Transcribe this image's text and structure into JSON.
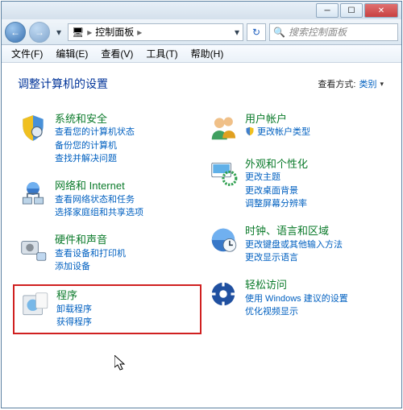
{
  "window": {
    "min_icon": "─",
    "max_icon": "☐",
    "close_icon": "✕"
  },
  "nav": {
    "back_glyph": "←",
    "fwd_glyph": "→",
    "drop_glyph": "▾",
    "address_icon": "🖥",
    "breadcrumb_sep": "▸",
    "breadcrumb_current": "控制面板",
    "refresh_glyph": "↻",
    "drop_small": "▾"
  },
  "search": {
    "icon": "🔍",
    "placeholder": "搜索控制面板"
  },
  "menu": {
    "items": [
      {
        "label": "文件(F)"
      },
      {
        "label": "编辑(E)"
      },
      {
        "label": "查看(V)"
      },
      {
        "label": "工具(T)"
      },
      {
        "label": "帮助(H)"
      }
    ]
  },
  "page": {
    "title": "调整计算机的设置",
    "view_label": "查看方式:",
    "view_value": "类别",
    "view_drop": "▾"
  },
  "left": [
    {
      "title": "系统和安全",
      "links": [
        "查看您的计算机状态",
        "备份您的计算机",
        "查找并解决问题"
      ]
    },
    {
      "title": "网络和 Internet",
      "links": [
        "查看网络状态和任务",
        "选择家庭组和共享选项"
      ]
    },
    {
      "title": "硬件和声音",
      "links": [
        "查看设备和打印机",
        "添加设备"
      ]
    },
    {
      "title": "程序",
      "links": [
        "卸载程序",
        "获得程序"
      ],
      "highlight": true
    }
  ],
  "right": [
    {
      "title": "用户帐户",
      "links": [
        "更改帐户类型"
      ],
      "icon_badge": true
    },
    {
      "title": "外观和个性化",
      "links": [
        "更改主题",
        "更改桌面背景",
        "调整屏幕分辨率"
      ]
    },
    {
      "title": "时钟、语言和区域",
      "links": [
        "更改键盘或其他输入方法",
        "更改显示语言"
      ]
    },
    {
      "title": "轻松访问",
      "links": [
        "使用 Windows 建议的设置",
        "优化视频显示"
      ]
    }
  ]
}
